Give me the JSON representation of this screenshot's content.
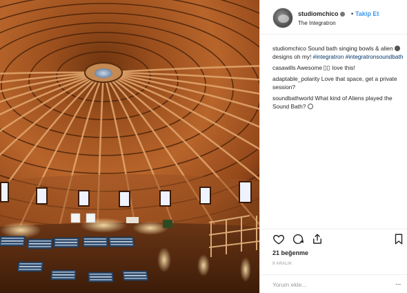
{
  "post": {
    "image_alt": "Interior of the wooden dome of The Integratron"
  },
  "header": {
    "username": "studiomchico",
    "separator": "•",
    "follow_label": "Takip Et",
    "location": "The Integratron"
  },
  "comments": [
    {
      "user": "studiomchico",
      "text_parts": [
        "Sound bath singing bowls &",
        "alien",
        "designs oh my!"
      ],
      "tags": [
        "#integratron",
        "#integratronsoundbath"
      ]
    },
    {
      "user": "casawills",
      "text_before": "Awesome",
      "text_after": "love this!"
    },
    {
      "user": "adaptable_polarity",
      "text": "Love that space, get a private session?"
    },
    {
      "user": "soundbathworld",
      "text": "What kind of Aliens played the Sound Bath?"
    }
  ],
  "actions": {
    "like_icon": "heart-outline-icon",
    "comment_icon": "speech-bubble-icon",
    "share_icon": "share-upload-icon",
    "save_icon": "bookmark-icon"
  },
  "likes_text": "21 beğenme",
  "date_text": "9 ARALIK",
  "add_comment": {
    "placeholder": "Yorum ekle...",
    "more_label": "..."
  },
  "colors": {
    "accent": "#3897f0",
    "hashtag": "#003569",
    "text": "#262626",
    "muted": "#999999",
    "wood": "#a4551f"
  }
}
